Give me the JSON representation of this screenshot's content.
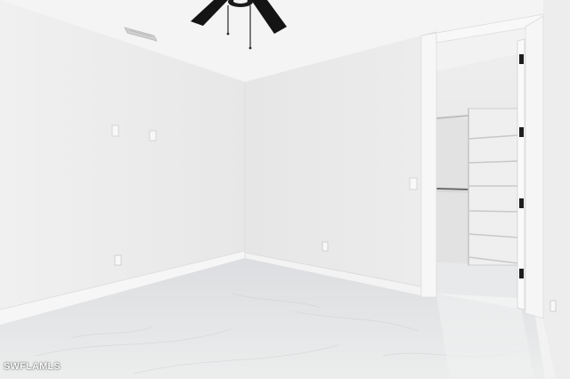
{
  "image": {
    "subject": "empty-room-with-walk-in-closet",
    "watermark": "SWFLAMLS"
  },
  "colors": {
    "left_wall": "#ececec",
    "back_wall": "#e9e9e9",
    "ceiling": "#f4f4f4",
    "floor": "#e2e3e5",
    "fan": "#141414"
  }
}
